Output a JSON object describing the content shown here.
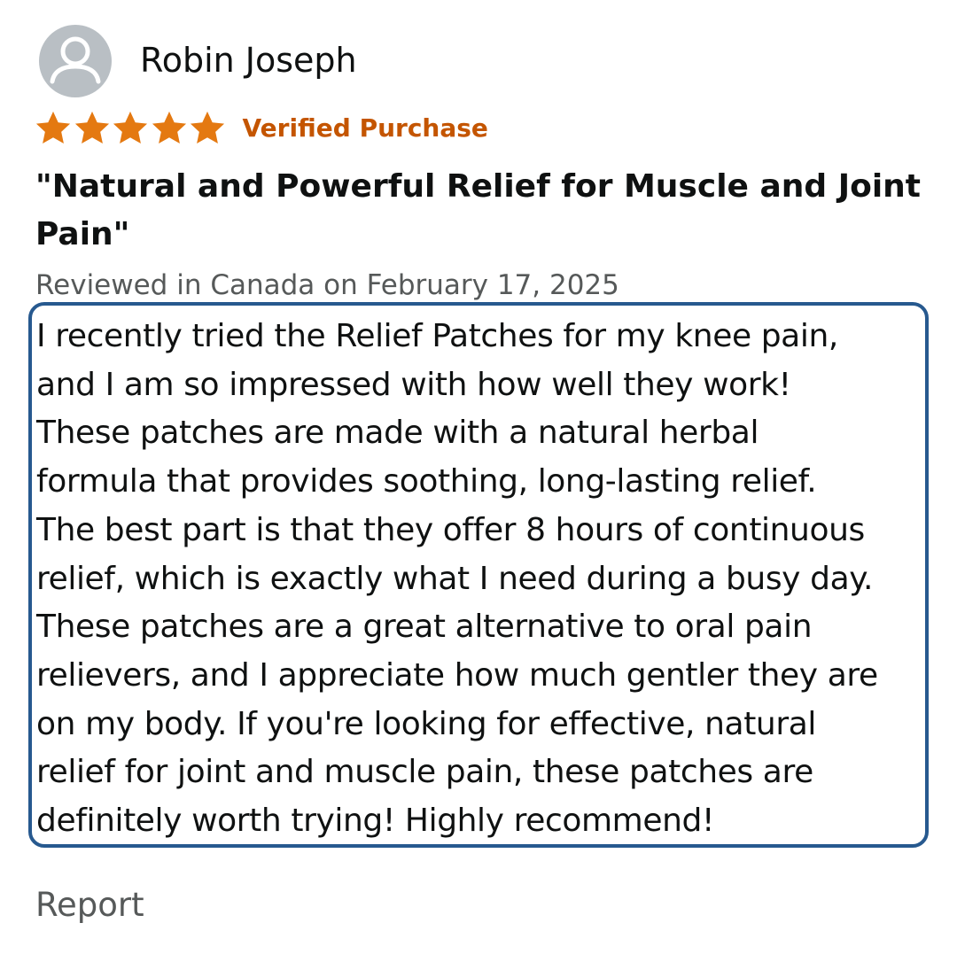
{
  "reviewer": {
    "name": "Robin Joseph",
    "avatar_icon": "user-avatar-icon"
  },
  "rating": {
    "stars": 5,
    "max": 5,
    "star_color": "#e47911",
    "star_icon": "star-icon"
  },
  "verified_label": "Verified Purchase",
  "verified_color": "#c45500",
  "review": {
    "title": "\"Natural and Powerful Relief for Muscle and Joint Pain\"",
    "meta": "Reviewed in Canada on February 17, 2025",
    "body_lines": [
      "I recently tried the Relief Patches for my knee pain,",
      "and I am so impressed with how well they work!",
      "These patches are made with a natural herbal",
      "formula that provides soothing, long-lasting relief.",
      "The best part is that they offer 8 hours of continuous",
      "relief, which is exactly what I need during a busy day.",
      "These patches are a great alternative to oral pain",
      "relievers, and I appreciate how much gentler they are",
      "on my body. If you're looking for effective, natural",
      "relief for joint and muscle pain, these patches are",
      "definitely worth trying! Highly recommend!"
    ],
    "highlight_color": "#27598f"
  },
  "actions": {
    "report_label": "Report"
  }
}
